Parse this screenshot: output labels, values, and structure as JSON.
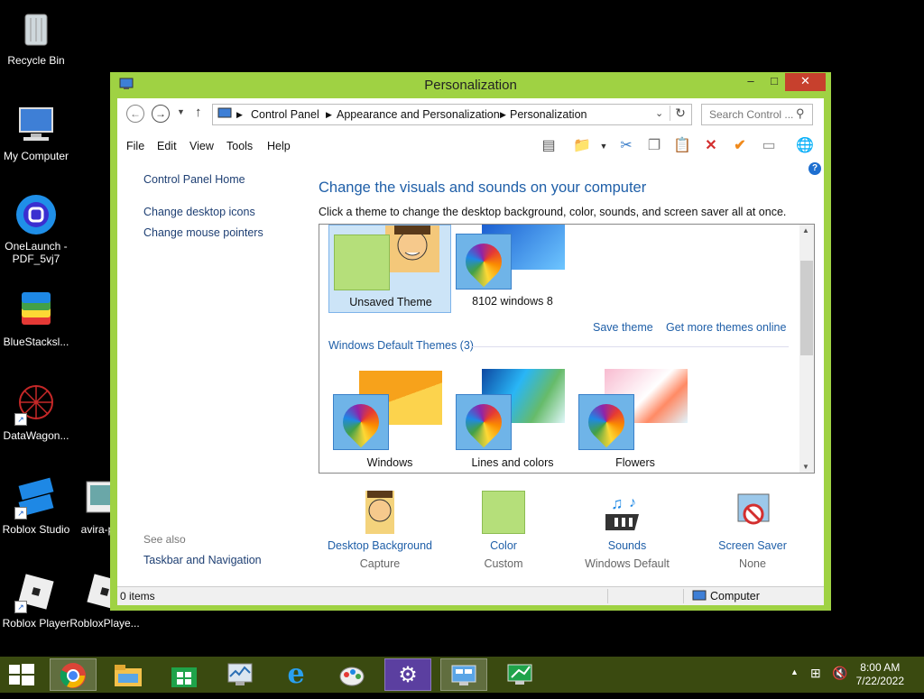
{
  "desktop": {
    "icons": [
      {
        "label": "Recycle Bin",
        "icon": "recycle-bin-icon"
      },
      {
        "label": "My Computer",
        "icon": "computer-icon"
      },
      {
        "label": "OneLaunch -\nPDF_5vj7",
        "icon": "onelaunch-icon"
      },
      {
        "label": "BlueStacksl...",
        "icon": "bluestacks-icon"
      },
      {
        "label": "DataWagon...",
        "icon": "datawagon-icon"
      },
      {
        "label": "Roblox Studio",
        "icon": "roblox-studio-icon"
      },
      {
        "label": "avira-pr",
        "icon": "avira-icon"
      },
      {
        "label": "Roblox Player",
        "icon": "roblox-player-icon"
      },
      {
        "label": "RobloxPlaye...",
        "icon": "roblox-player-icon"
      }
    ]
  },
  "window": {
    "title": "Personalization",
    "controls": {
      "minimize": "–",
      "maximize": "□",
      "close": "✕"
    },
    "breadcrumb": [
      "Control Panel",
      "Appearance and Personalization",
      "Personalization"
    ],
    "search_placeholder": "Search Control ...",
    "menus": [
      "File",
      "Edit",
      "View",
      "Tools",
      "Help"
    ],
    "sidebar": {
      "home": "Control Panel Home",
      "links": [
        "Change desktop icons",
        "Change mouse pointers"
      ],
      "see_also": "See also",
      "see_also_links": [
        "Taskbar and Navigation"
      ]
    },
    "heading": "Change the visuals and sounds on your computer",
    "subheading": "Click a theme to change the desktop background, color, sounds, and screen saver all at once.",
    "my_themes": [
      {
        "name": "Unsaved Theme",
        "selected": true
      },
      {
        "name": "8102 windows 8",
        "selected": false
      }
    ],
    "save_theme": "Save theme",
    "get_more_themes": "Get more themes online",
    "default_group_title": "Windows Default Themes (3)",
    "default_themes": [
      {
        "name": "Windows"
      },
      {
        "name": "Lines and colors"
      },
      {
        "name": "Flowers"
      }
    ],
    "bottom_items": [
      {
        "label": "Desktop Background",
        "value": "Capture"
      },
      {
        "label": "Color",
        "value": "Custom"
      },
      {
        "label": "Sounds",
        "value": "Windows Default"
      },
      {
        "label": "Screen Saver",
        "value": "None"
      }
    ],
    "status_left": "0 items",
    "status_right": "Computer"
  },
  "taskbar": {
    "apps": [
      "chrome-icon",
      "file-explorer-icon",
      "store-icon",
      "task-manager-icon",
      "internet-explorer-icon",
      "paint-icon",
      "settings-icon",
      "control-panel-icon",
      "remote-desktop-icon"
    ],
    "time": "8:00 AM",
    "date": "7/22/2022"
  },
  "colors": {
    "window_border": "#9fd243",
    "taskbar": "#3a4a10",
    "close_button": "#c7402d",
    "link": "#1f5fa8"
  }
}
